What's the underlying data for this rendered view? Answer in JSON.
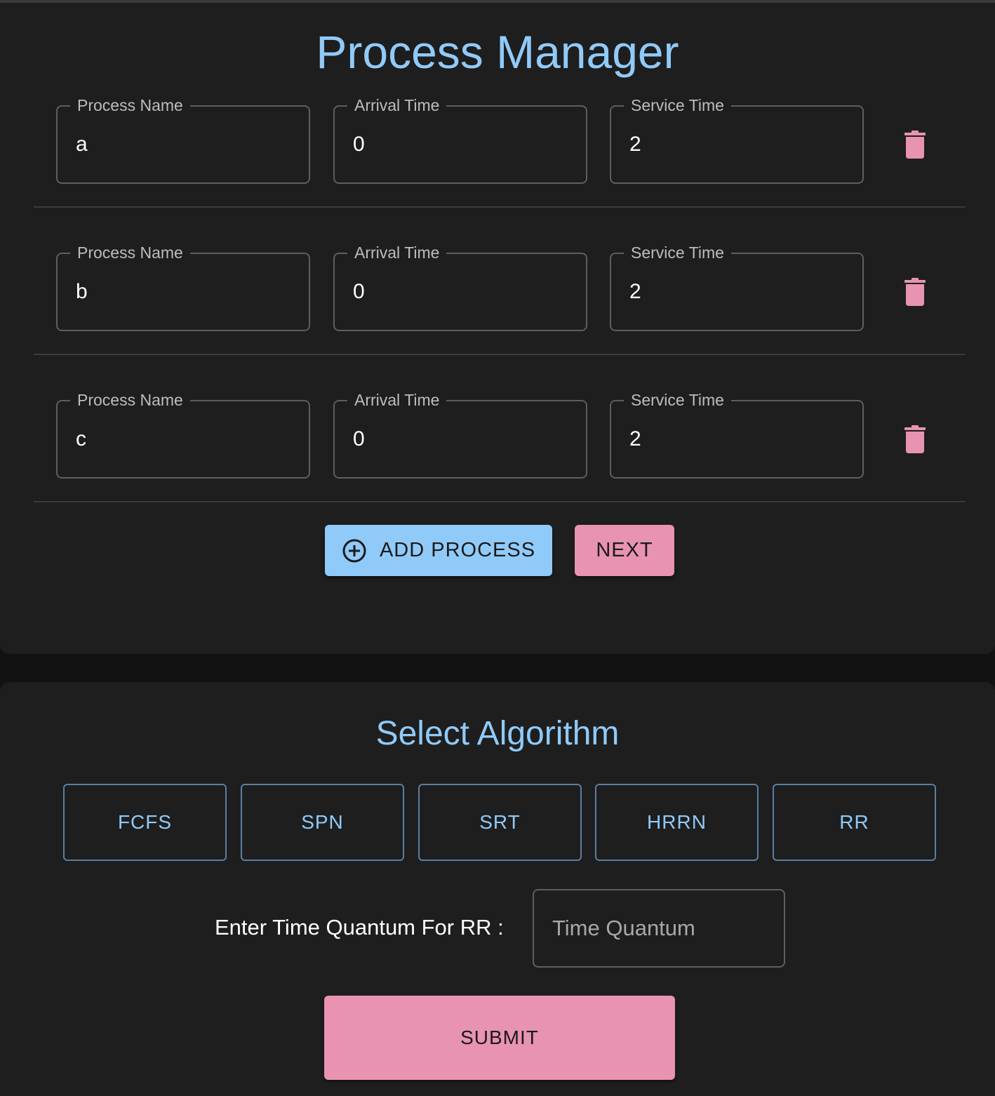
{
  "header": {
    "title": "Process Manager"
  },
  "process_form": {
    "labels": {
      "name": "Process Name",
      "arrival": "Arrival Time",
      "service": "Service Time"
    },
    "rows": [
      {
        "name": "a",
        "arrival": "0",
        "service": "2"
      },
      {
        "name": "b",
        "arrival": "0",
        "service": "2"
      },
      {
        "name": "c",
        "arrival": "0",
        "service": "2"
      }
    ],
    "add_button": "ADD PROCESS",
    "next_button": "NEXT"
  },
  "algorithm": {
    "title": "Select Algorithm",
    "options": [
      "FCFS",
      "SPN",
      "SRT",
      "HRRN",
      "RR"
    ],
    "quantum_label": "Enter Time Quantum For RR :",
    "quantum_placeholder": "Time Quantum",
    "submit_button": "SUBMIT"
  },
  "colors": {
    "accent_blue": "#90caf9",
    "accent_pink": "#e893b1",
    "card_bg": "#1e1e1e",
    "page_bg": "#121212"
  },
  "icons": {
    "delete": "trash-icon",
    "add": "add-circle-icon"
  }
}
